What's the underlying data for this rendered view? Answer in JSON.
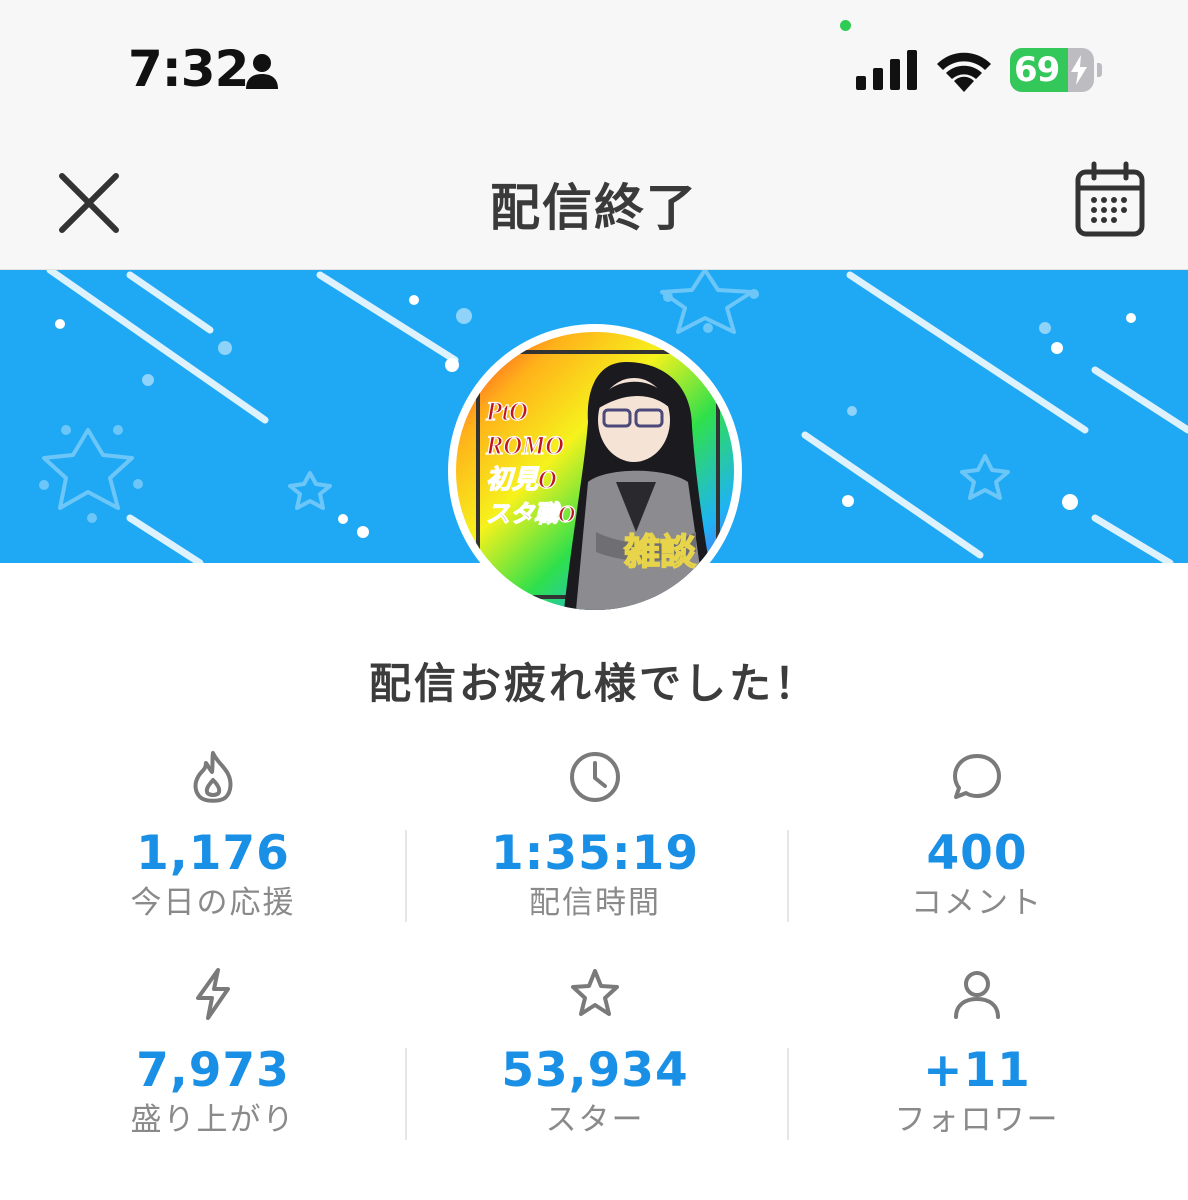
{
  "status_bar": {
    "time": "7:32",
    "battery_percent": "69",
    "battery_level": 0.69,
    "icons": [
      "person-icon",
      "signal-icon",
      "wifi-icon",
      "battery-icon",
      "charging-bolt-icon"
    ]
  },
  "header": {
    "title": "配信終了",
    "close_icon": "close-icon",
    "calendar_icon": "calendar-icon"
  },
  "banner": {
    "background_color": "#1fa9f5",
    "avatar_texts": [
      "PtO",
      "ROMO",
      "初見O",
      "スタ職O",
      "雑談"
    ]
  },
  "message": "配信お疲れ様でした！",
  "stats": [
    {
      "icon": "flame-icon",
      "value": "1,176",
      "label": "今日の応援"
    },
    {
      "icon": "clock-icon",
      "value": "1:35:19",
      "label": "配信時間"
    },
    {
      "icon": "comment-icon",
      "value": "400",
      "label": "コメント"
    },
    {
      "icon": "lightning-icon",
      "value": "7,973",
      "label": "盛り上がり"
    },
    {
      "icon": "star-icon",
      "value": "53,934",
      "label": "スター"
    },
    {
      "icon": "follower-icon",
      "value": "+11",
      "label": "フォロワー"
    }
  ],
  "colors": {
    "accent": "#1a8fe6",
    "label": "#8a8a8a",
    "icon": "#7a7a7a"
  }
}
